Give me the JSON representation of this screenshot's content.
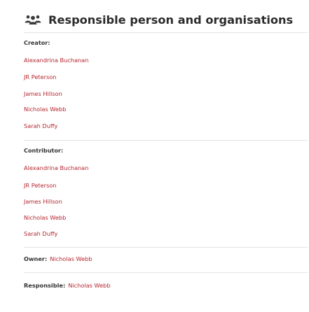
{
  "header": {
    "title": "Responsible person and organisations",
    "icon": "people-group-icon"
  },
  "colors": {
    "link": "#b5262f",
    "text": "#333333",
    "divider": "#e3e3e3"
  },
  "creator": {
    "label": "Creator:",
    "people": [
      "Alexandrina Buchanan",
      "JR Peterson",
      "James Hillson",
      "Nicholas Webb",
      "Sarah Duffy"
    ]
  },
  "contributor": {
    "label": "Contributor:",
    "people": [
      "Alexandrina Buchanan",
      "JR Peterson",
      "James Hillson",
      "Nicholas Webb",
      "Sarah Duffy"
    ]
  },
  "owner": {
    "label": "Owner:",
    "value": "Nicholas Webb"
  },
  "responsible": {
    "label": "Responsible:",
    "value": "Nicholas Webb"
  }
}
